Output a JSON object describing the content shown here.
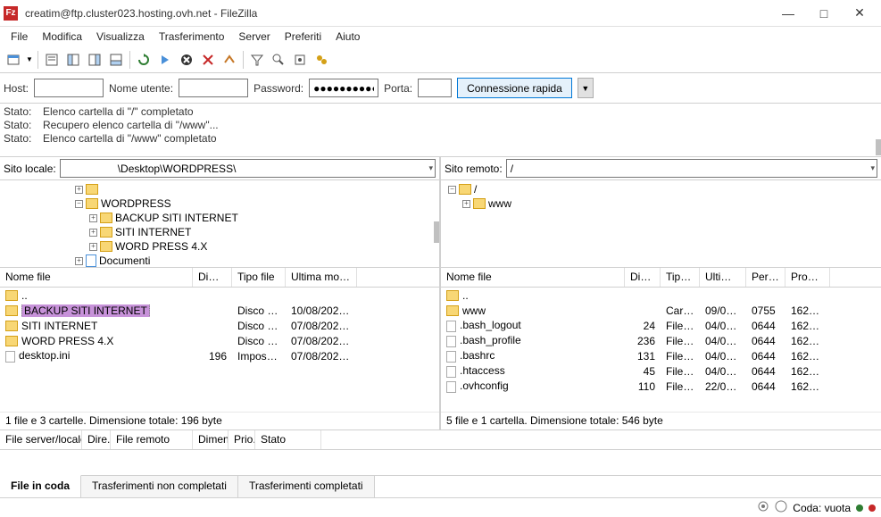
{
  "title": "creatim@ftp.cluster023.hosting.ovh.net - FileZilla",
  "menubar": [
    "File",
    "Modifica",
    "Visualizza",
    "Trasferimento",
    "Server",
    "Preferiti",
    "Aiuto"
  ],
  "quickconn": {
    "host_label": "Host:",
    "user_label": "Nome utente:",
    "pass_label": "Password:",
    "pass_value": "●●●●●●●●●●●●●●●",
    "port_label": "Porta:",
    "button": "Connessione rapida"
  },
  "log": [
    {
      "label": "Stato:",
      "msg": "Elenco cartella di \"/\" completato"
    },
    {
      "label": "Stato:",
      "msg": "Recupero elenco cartella di \"/www\"..."
    },
    {
      "label": "Stato:",
      "msg": "Elenco cartella di \"/www\" completato"
    }
  ],
  "sitebar": {
    "local_label": "Sito locale:",
    "local_path": "\\Desktop\\WORDPRESS\\",
    "remote_label": "Sito remoto:",
    "remote_path": "/"
  },
  "localtree": {
    "wordpress": "WORDPRESS",
    "backup": "BACKUP SITI INTERNET",
    "siti": "SITI INTERNET",
    "wp4": "WORD PRESS 4.X",
    "docs": "Documenti"
  },
  "remotetree": {
    "root": "/",
    "www": "www"
  },
  "listcols_local": [
    "Nome file",
    "Dimen...",
    "Tipo file",
    "Ultima mod..."
  ],
  "listcols_remote": [
    "Nome file",
    "Dime...",
    "Tipo file",
    "Ultima m...",
    "Perme...",
    "Proprie..."
  ],
  "local_files": [
    {
      "name": "..",
      "size": "",
      "type": "",
      "mod": "",
      "icon": "up"
    },
    {
      "name": "BACKUP SITI INTERNET",
      "size": "",
      "type": "Disco locale",
      "mod": "10/08/2024...",
      "icon": "folder",
      "sel": true
    },
    {
      "name": "SITI INTERNET",
      "size": "",
      "type": "Disco locale",
      "mod": "07/08/2024...",
      "icon": "folder"
    },
    {
      "name": "WORD PRESS 4.X",
      "size": "",
      "type": "Disco locale",
      "mod": "07/08/2024...",
      "icon": "folder"
    },
    {
      "name": "desktop.ini",
      "size": "196",
      "type": "Impostazio...",
      "mod": "07/08/2024...",
      "icon": "file"
    }
  ],
  "remote_files": [
    {
      "name": "..",
      "size": "",
      "type": "",
      "mod": "",
      "perm": "",
      "own": "",
      "icon": "up"
    },
    {
      "name": "www",
      "size": "",
      "type": "Cartell...",
      "mod": "09/08/20...",
      "perm": "0755",
      "own": "162011...",
      "icon": "folder"
    },
    {
      "name": ".bash_logout",
      "size": "24",
      "type": "File BA...",
      "mod": "04/05/20...",
      "perm": "0644",
      "own": "162011...",
      "icon": "file"
    },
    {
      "name": ".bash_profile",
      "size": "236",
      "type": "File BA...",
      "mod": "04/05/20...",
      "perm": "0644",
      "own": "162011...",
      "icon": "file"
    },
    {
      "name": ".bashrc",
      "size": "131",
      "type": "File BA...",
      "mod": "04/05/20...",
      "perm": "0644",
      "own": "162011...",
      "icon": "file"
    },
    {
      "name": ".htaccess",
      "size": "45",
      "type": "File HT...",
      "mod": "04/05/20...",
      "perm": "0644",
      "own": "162011...",
      "icon": "file"
    },
    {
      "name": ".ovhconfig",
      "size": "110",
      "type": "File OV...",
      "mod": "22/06/20...",
      "perm": "0644",
      "own": "162011...",
      "icon": "file"
    }
  ],
  "local_status": "1 file e 3 cartelle. Dimensione totale: 196 byte",
  "remote_status": "5 file e 1 cartella. Dimensione totale: 546 byte",
  "queuecols": [
    "File server/locale",
    "Dire...",
    "File remoto",
    "Dimen...",
    "Prio...",
    "Stato"
  ],
  "tabs": [
    "File in coda",
    "Trasferimenti non completati",
    "Trasferimenti completati"
  ],
  "statusbar": {
    "queue": "Coda: vuota"
  }
}
